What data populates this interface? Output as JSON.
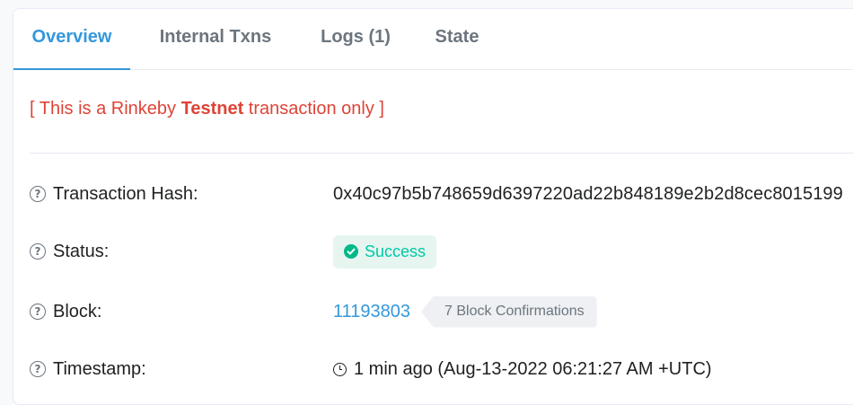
{
  "tabs": [
    {
      "label": "Overview",
      "active": true
    },
    {
      "label": "Internal Txns",
      "active": false
    },
    {
      "label": "Logs (1)",
      "active": false
    },
    {
      "label": "State",
      "active": false
    }
  ],
  "notice": {
    "prefix": "[ This is a Rinkeby ",
    "emphasis": "Testnet",
    "suffix": " transaction only ]"
  },
  "rows": {
    "hash": {
      "label": "Transaction Hash:",
      "value": "0x40c97b5b748659d6397220ad22b848189e2b2d8cec8015199"
    },
    "status": {
      "label": "Status:",
      "value": "Success"
    },
    "block": {
      "label": "Block:",
      "value": "11193803",
      "confirmations": "7 Block Confirmations"
    },
    "timestamp": {
      "label": "Timestamp:",
      "value": "1 min ago (Aug-13-2022 06:21:27 AM +UTC)"
    }
  },
  "icons": {
    "help": "question-circle-icon",
    "success": "check-circle-icon",
    "clock": "clock-icon"
  },
  "colors": {
    "accent": "#3498db",
    "danger": "#de4437",
    "success": "#00c9a7",
    "text": "#1e2022",
    "muted": "#6c757e"
  }
}
